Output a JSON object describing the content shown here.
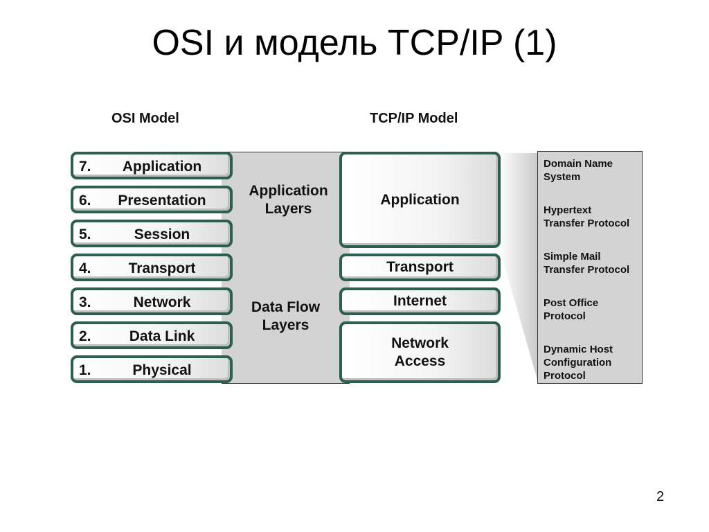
{
  "slide": {
    "title": "OSI и модель TCP/IP (1)",
    "page_number": "2"
  },
  "osi_model": {
    "heading": "OSI Model",
    "layers": [
      {
        "num": "7.",
        "name": "Application"
      },
      {
        "num": "6.",
        "name": "Presentation"
      },
      {
        "num": "5.",
        "name": "Session"
      },
      {
        "num": "4.",
        "name": "Transport"
      },
      {
        "num": "3.",
        "name": "Network"
      },
      {
        "num": "2.",
        "name": "Data Link"
      },
      {
        "num": "1.",
        "name": "Physical"
      }
    ]
  },
  "groups": {
    "application_layers": "Application Layers",
    "data_flow_layers": "Data Flow Layers"
  },
  "tcpip_model": {
    "heading": "TCP/IP Model",
    "layers": [
      {
        "name": "Application"
      },
      {
        "name": "Transport"
      },
      {
        "name": "Internet"
      },
      {
        "name": "Network Access"
      }
    ]
  },
  "protocols": [
    "Domain Name System",
    "Hypertext Transfer Protocol",
    "Simple Mail Transfer Protocol",
    "Post Office Protocol",
    "Dynamic Host Configuration Protocol"
  ],
  "colors": {
    "layer_border": "#2c5f4e",
    "band_gray": "#d3d3d3"
  }
}
